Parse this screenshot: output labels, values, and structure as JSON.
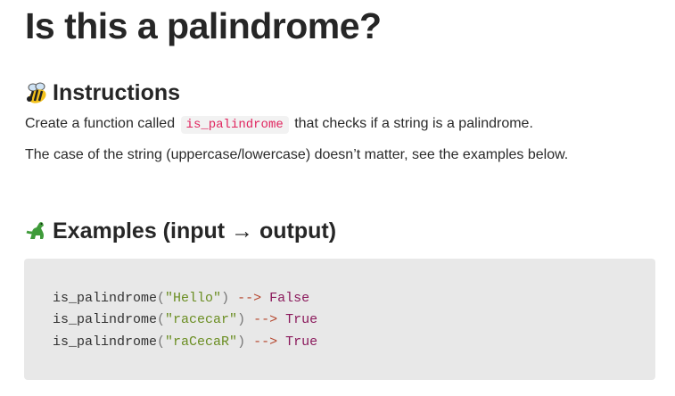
{
  "page": {
    "title": "Is this a palindrome?"
  },
  "instructions": {
    "heading": "Instructions",
    "icon": "bee-icon",
    "line1_before": "Create a function called ",
    "line1_code": "is_palindrome",
    "line1_after": " that checks if a string is a palindrome.",
    "line2": "The case of the string (uppercase/lowercase) doesn’t matter, see the examples below."
  },
  "examples": {
    "heading": "Examples (input → output)",
    "icon": "dinosaur-icon",
    "lines": [
      {
        "fn": "is_palindrome",
        "open": "(",
        "arg": "\"Hello\"",
        "close": ")",
        "arrow": " --> ",
        "result": "False"
      },
      {
        "fn": "is_palindrome",
        "open": "(",
        "arg": "\"racecar\"",
        "close": ")",
        "arrow": " --> ",
        "result": "True"
      },
      {
        "fn": "is_palindrome",
        "open": "(",
        "arg": "\"raCecaR\"",
        "close": ")",
        "arrow": " --> ",
        "result": "True"
      }
    ]
  },
  "colors": {
    "inline_code": "#e0245e",
    "code_bg": "#e8e8e8",
    "string": "#6b8e23",
    "arrow": "#b5452c",
    "boolean": "#8b1a5c"
  }
}
